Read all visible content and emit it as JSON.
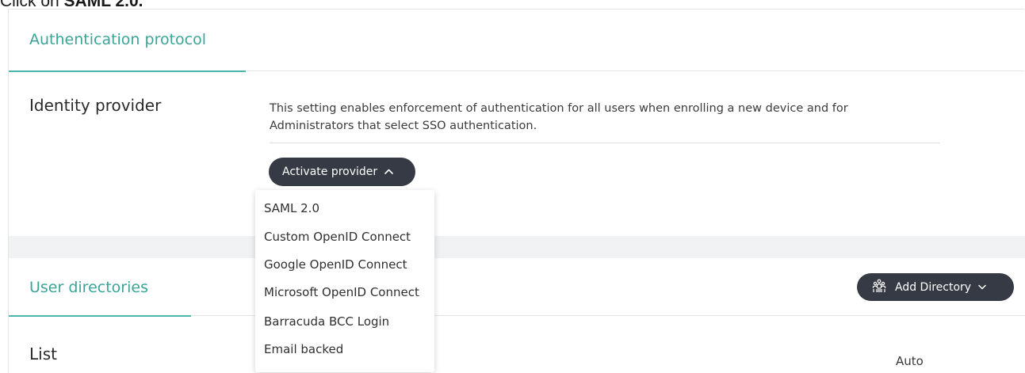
{
  "instruction": {
    "prefix": "Click on ",
    "target": "SAML 2.0."
  },
  "auth_section": {
    "title": "Authentication protocol",
    "identity_provider_label": "Identity provider",
    "description_line1": "This setting enables enforcement of authentication for all users when enrolling a new device and for",
    "description_line2": "Administrators that select SSO authentication.",
    "activate_button_label": "Activate provider"
  },
  "provider_menu": {
    "items": [
      "SAML 2.0",
      "Custom OpenID Connect",
      "Google OpenID Connect",
      "Microsoft OpenID Connect",
      "Barracuda BCC Login",
      "Email backed"
    ]
  },
  "directories_section": {
    "title": "User directories",
    "add_button_label": "Add Directory",
    "list_label": "List",
    "auto_label": "Auto"
  },
  "colors": {
    "accent": "#3aa597",
    "button_bg": "#353a44"
  },
  "icons": {
    "activate_chevron": "chevron-up-icon",
    "add_dir_chevron": "chevron-down-icon",
    "add_dir_icon": "users-group-icon"
  }
}
